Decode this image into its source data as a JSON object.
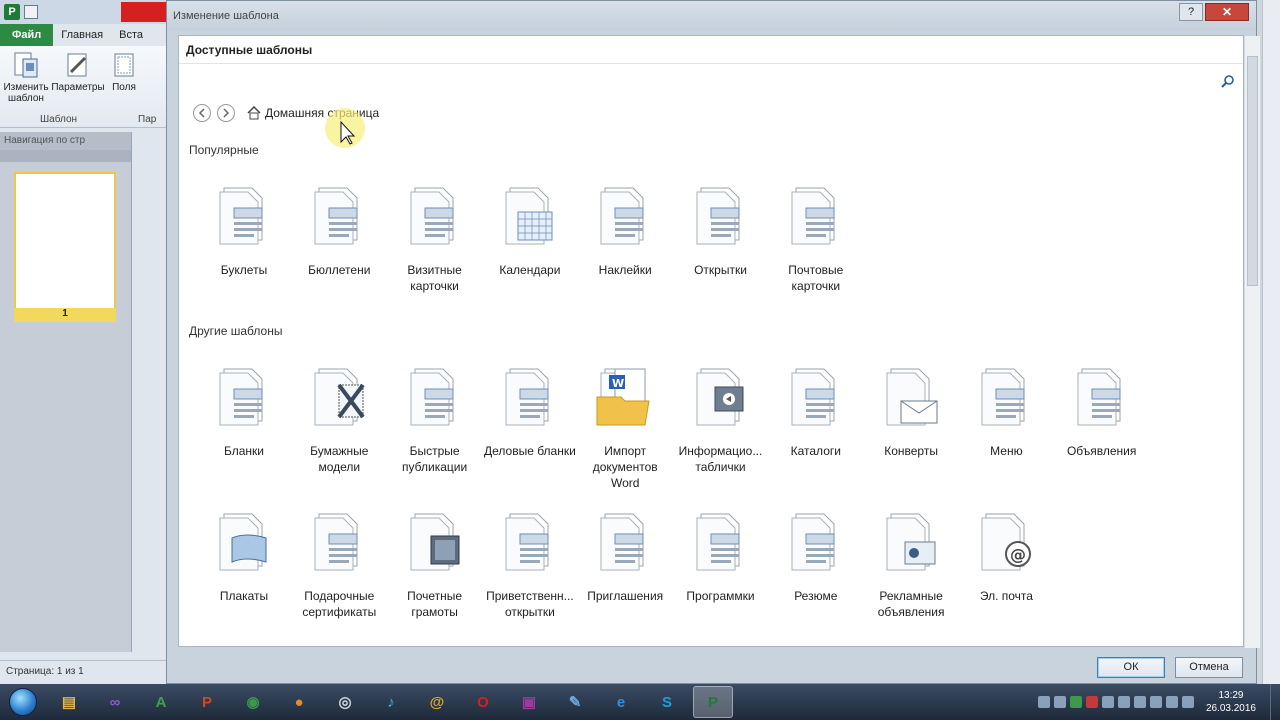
{
  "app": {
    "file_tab": "Файл",
    "home_tab": "Главная",
    "insert_tab": "Вста",
    "change_template_label": "Изменить шаблон",
    "parameters_label": "Параметры",
    "fields_label": "Поля",
    "group_template": "Шаблон",
    "group_page": "Пар",
    "thumbnail_header": "Навигация по стр",
    "page_number": "1",
    "status": "Страница: 1 из 1"
  },
  "dialog": {
    "title": "Изменение шаблона",
    "help_glyph": "?",
    "close_glyph": "✕",
    "header": "Доступные шаблоны",
    "breadcrumb": "Домашняя страница",
    "section_popular": "Популярные",
    "section_other": "Другие шаблоны",
    "ok": "ОК",
    "cancel": "Отмена"
  },
  "popular": [
    {
      "label": "Буклеты",
      "icon": "booklet-icon"
    },
    {
      "label": "Бюллетени",
      "icon": "newsletter-icon"
    },
    {
      "label": "Визитные карточки",
      "icon": "business-card-icon"
    },
    {
      "label": "Календари",
      "icon": "calendar-icon"
    },
    {
      "label": "Наклейки",
      "icon": "label-icon"
    },
    {
      "label": "Открытки",
      "icon": "greeting-card-icon"
    },
    {
      "label": "Почтовые карточки",
      "icon": "postcard-icon"
    }
  ],
  "other_row1": [
    {
      "label": "Бланки",
      "icon": "form-icon"
    },
    {
      "label": "Бумажные модели",
      "icon": "paper-model-icon"
    },
    {
      "label": "Быстрые публикации",
      "icon": "quick-publication-icon"
    },
    {
      "label": "Деловые бланки",
      "icon": "business-form-icon"
    },
    {
      "label": "Импорт документов Word",
      "icon": "word-import-icon"
    },
    {
      "label": "Информацио... таблички",
      "icon": "sign-icon"
    },
    {
      "label": "Каталоги",
      "icon": "catalog-icon"
    },
    {
      "label": "Конверты",
      "icon": "envelope-icon"
    },
    {
      "label": "Меню",
      "icon": "menu-icon"
    },
    {
      "label": "Объявления",
      "icon": "flyer-icon"
    }
  ],
  "other_row2": [
    {
      "label": "Плакаты",
      "icon": "banner-icon"
    },
    {
      "label": "Подарочные сертификаты",
      "icon": "gift-certificate-icon"
    },
    {
      "label": "Почетные грамоты",
      "icon": "award-certificate-icon"
    },
    {
      "label": "Приветственн... открытки",
      "icon": "welcome-card-icon"
    },
    {
      "label": "Приглашения",
      "icon": "invitation-icon"
    },
    {
      "label": "Программки",
      "icon": "program-icon"
    },
    {
      "label": "Резюме",
      "icon": "resume-icon"
    },
    {
      "label": "Рекламные объявления",
      "icon": "advertisement-icon"
    },
    {
      "label": "Эл. почта",
      "icon": "email-icon"
    }
  ],
  "taskbar": {
    "time": "13:29",
    "date": "26.03.2016",
    "apps": [
      "explorer-icon",
      "vs-icon",
      "a-icon",
      "powerpoint-icon",
      "network-icon",
      "ball-icon",
      "media-icon",
      "itunes-icon",
      "at-icon",
      "opera-icon",
      "video-icon",
      "paint-icon",
      "ie-icon",
      "skype-icon",
      "publisher-icon"
    ]
  }
}
